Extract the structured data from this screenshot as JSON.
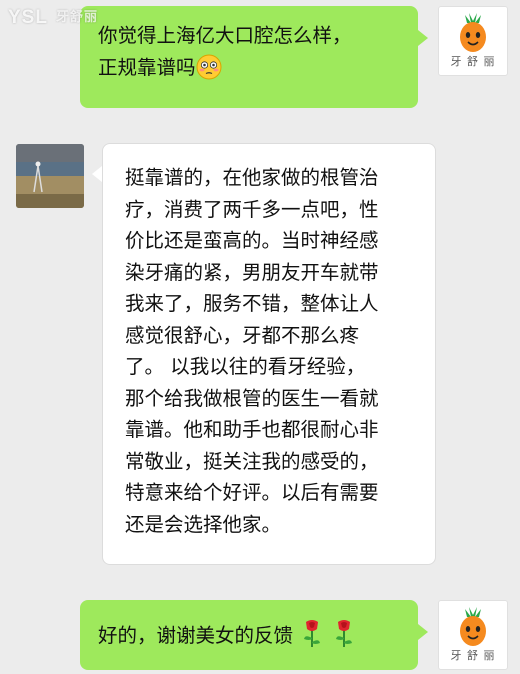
{
  "watermark": {
    "text": "YSL",
    "sub": "牙舒丽"
  },
  "messages": [
    {
      "direction": "out",
      "sender": "brand",
      "lines": [
        "你觉得上海亿大口腔怎么样，",
        "正规靠谱吗"
      ],
      "emoji": "flushed-face"
    },
    {
      "direction": "in",
      "sender": "user",
      "lines": [
        "挺靠谱的，在他家做的根管治",
        "疗，消费了两千多一点吧，性",
        "价比还是蛮高的。当时神经感",
        "染牙痛的紧，男朋友开车就带",
        "我来了，服务不错，整体让人",
        "感觉很舒心，牙都不那么疼",
        "了。 以我以往的看牙经验，",
        "那个给我做根管的医生一看就",
        "靠谱。他和助手也都很耐心非",
        "常敬业，挺关注我的感受的，",
        "特意来给个好评。以后有需要",
        "还是会选择他家。"
      ]
    },
    {
      "direction": "out",
      "sender": "brand",
      "lines": [
        "好的，谢谢美女的反馈"
      ],
      "emoji": "rose-rose"
    }
  ],
  "brand_avatar": {
    "caption": "牙 舒 丽"
  },
  "colors": {
    "background": "#ececec",
    "outgoing_bubble": "#9ee95c",
    "incoming_bubble": "#ffffff",
    "carrot": "#f58a1f",
    "leaf": "#2aa84a"
  }
}
